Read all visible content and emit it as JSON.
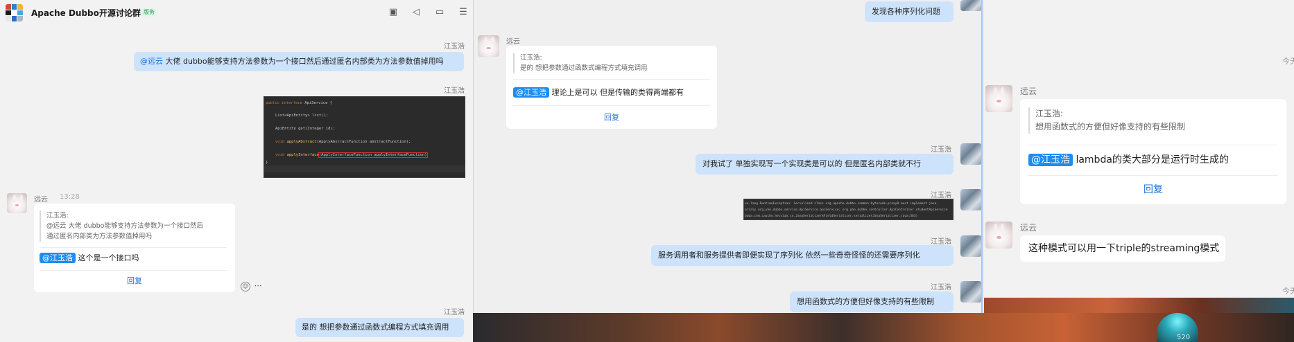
{
  "left": {
    "header": {
      "title": "Apache Dubbo开源讨论群 2",
      "badge": "版务"
    },
    "messages": {
      "m1_sender": "江玉浩",
      "m1_mention": "@远云",
      "m1_text": " 大佬  dubbo能够支持方法参数为一个接口然后通过匿名内部类为方法参数值掉用吗",
      "m2_sender": "江玉浩",
      "code": {
        "l1a": "public interface ",
        "l1b": "ApiService {",
        "l2": "List<ApiEntity> list();",
        "l3": "ApiEntity get(Integer id);",
        "l4a": "void ",
        "l4b": "applyAbstract",
        "l4c": "(ApplyAbstractFunction abstractFunction);",
        "l5a": "void ",
        "l5b": "applyInterface",
        "l5c": "(ApplyInterfaceFunction applyInterfaceFunction)",
        "l6": "}"
      },
      "m3_sender": "远云",
      "m3_time": "13:28",
      "m3_quote_name": "江玉浩:",
      "m3_quote_line1": "@远云 大佬  dubbo能够支持方法参数为一个接口然后",
      "m3_quote_line2": "通过匿名内部类为方法参数值掉用吗",
      "m3_mention": "@江玉浩",
      "m3_text": " 这个是一个接口吗",
      "m3_reply": "回复",
      "m4_sender": "江玉浩",
      "m4_text": "是的  想把参数通过函数式编程方式填充调用"
    }
  },
  "middle": {
    "m0_text": "发现各种序列化问题",
    "m1_sender": "远云",
    "m1_quote_name": "江玉浩:",
    "m1_quote_text": "是的  想把参数通过函数式编程方式填充调用",
    "m1_mention": "@江玉浩",
    "m1_text": " 理论上是可以 但是传输的类得两端都有",
    "m1_reply": "回复",
    "m2_sender": "江玉浩",
    "m2_text": "对我试了  单独实现写一个实现类是可以的  但是匿名内部类就不行",
    "m3_sender": "江玉浩",
    "err": {
      "l1": "va.lang.RuntimeException: Serialized class org.apache.dubbo.common.bytecode.proxy0 must implement java.",
      "l2": "orialy org.yhe.dubbo.service.ApiService apiService; org.yhe.dubbo.controller.ApiController.studentApiService",
      "l3": "baba.com.caucho.hessian.io.JavaSerializer$FieldSerializer.serialize(JavaSerializer.java:363)"
    },
    "m4_sender": "江玉浩",
    "m4_text": "服务调用者和服务提供者即便实现了序列化  依然一些奇奇怪怪的还需要序列化",
    "m5_sender": "江玉浩",
    "m5_text": "想用函数式的方便但好像支持的有些限制"
  },
  "right": {
    "time1": "今天",
    "m1_sender": "远云",
    "m1_quote_name": "江玉浩:",
    "m1_quote_text": "想用函数式的方便但好像支持的有些限制",
    "m1_mention": "@江玉浩",
    "m1_text": " lambda的类大部分是运行时生成的",
    "m1_reply": "回复",
    "m2_sender": "远云",
    "m2_text": "这种模式可以用一下triple的streaming模式",
    "time2": "今天"
  },
  "wallpaper": {
    "number": "520"
  },
  "colors": {
    "accent": "#1e8cf0",
    "bubble_self": "#cde3fb",
    "bubble_other": "#ffffff"
  }
}
